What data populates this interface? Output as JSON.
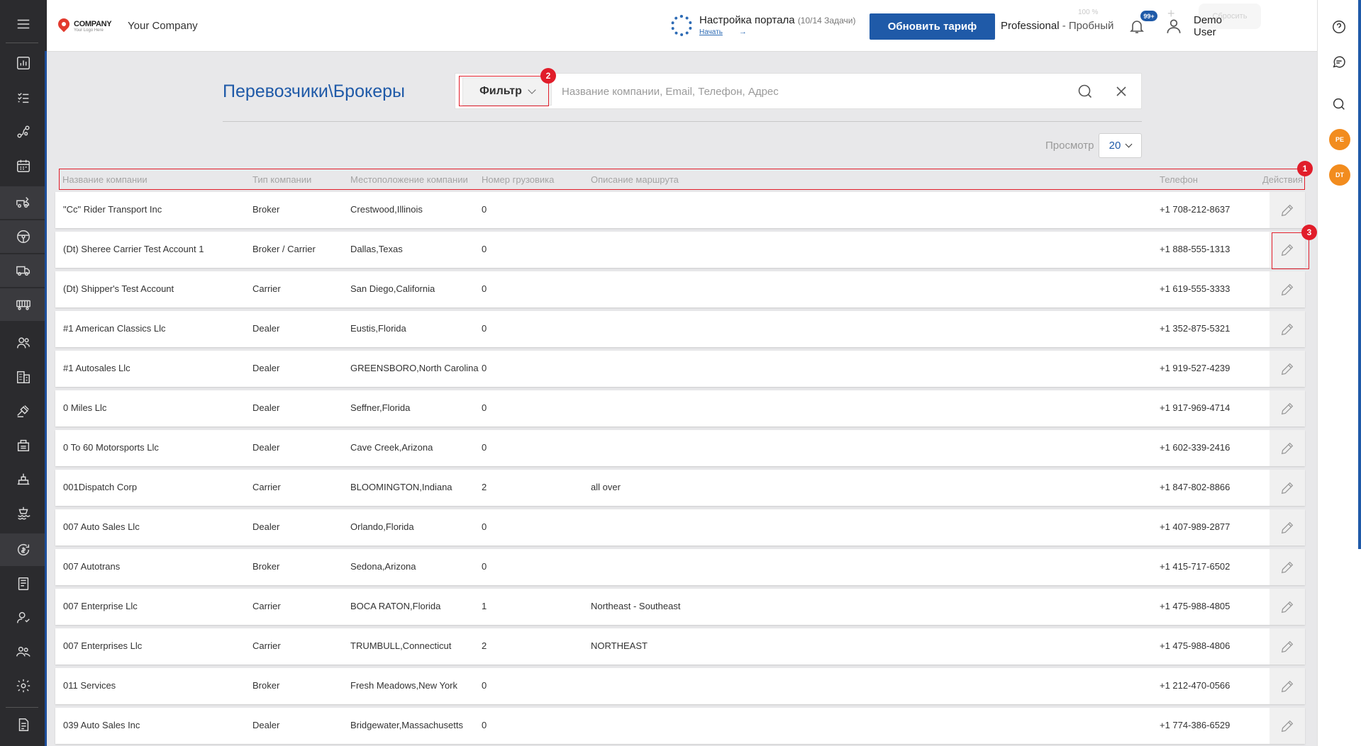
{
  "sidebar": {
    "items": [
      {
        "name": "menu-icon"
      },
      {
        "name": "dashboard-icon"
      },
      {
        "name": "tasks-icon"
      },
      {
        "name": "routes-icon"
      },
      {
        "name": "calendar-icon"
      },
      {
        "name": "dispatch-icon"
      },
      {
        "name": "steering-wheel-icon"
      },
      {
        "name": "truck-icon"
      },
      {
        "name": "trailer-icon"
      },
      {
        "name": "contacts-icon"
      },
      {
        "name": "buildings-icon"
      },
      {
        "name": "auction-icon"
      },
      {
        "name": "warehouse-icon"
      },
      {
        "name": "terminal-icon"
      },
      {
        "name": "port-icon"
      },
      {
        "name": "billing-icon"
      },
      {
        "name": "reports-icon"
      },
      {
        "name": "user-settings-icon"
      },
      {
        "name": "team-icon"
      },
      {
        "name": "settings-icon"
      },
      {
        "name": "document-icon"
      }
    ]
  },
  "header": {
    "logo_text": "COMPANY",
    "logo_sub": "Your Logo Here",
    "company_name": "Your Company",
    "portal_title": "Настройка портала",
    "portal_count": "(10/14 Задачи)",
    "portal_link": "Начать",
    "upgrade_label": "Обновить тариф",
    "plan": "Professional",
    "plan_trial": " - Пробный",
    "ghost_percent": "100 %",
    "ghost_reset": "Сбросить",
    "notifications_badge": "99+",
    "user_name": "Demo User"
  },
  "right_rail": {
    "avatars": [
      "PE",
      "DT"
    ]
  },
  "page": {
    "title": "Перевозчики\\Брокеры",
    "filter_label": "Фильтр",
    "search_placeholder": "Название компании, Email, Телефон, Адрес",
    "view_label": "Просмотр",
    "page_size": "20"
  },
  "table": {
    "columns": [
      "Название компании",
      "Тип компании",
      "Местоположение компании",
      "Номер грузовика",
      "Описание маршрута",
      "Телефон",
      "Действия"
    ],
    "rows": [
      {
        "name": "\"Cc\" Rider Transport Inc",
        "type": "Broker",
        "location": "Crestwood,Illinois",
        "trucks": "0",
        "route": "",
        "phone": "+1 708-212-8637"
      },
      {
        "name": "(Dt) Sheree Carrier Test Account 1",
        "type": "Broker / Carrier",
        "location": "Dallas,Texas",
        "trucks": "0",
        "route": "",
        "phone": "+1 888-555-1313"
      },
      {
        "name": "(Dt) Shipper's Test Account",
        "type": "Carrier",
        "location": "San Diego,California",
        "trucks": "0",
        "route": "",
        "phone": "+1 619-555-3333"
      },
      {
        "name": "#1 American Classics Llc",
        "type": "Dealer",
        "location": "Eustis,Florida",
        "trucks": "0",
        "route": "",
        "phone": "+1 352-875-5321"
      },
      {
        "name": "#1 Autosales Llc",
        "type": "Dealer",
        "location": "GREENSBORO,North Carolina",
        "trucks": "0",
        "route": "",
        "phone": "+1 919-527-4239"
      },
      {
        "name": "0 Miles Llc",
        "type": "Dealer",
        "location": "Seffner,Florida",
        "trucks": "0",
        "route": "",
        "phone": "+1 917-969-4714"
      },
      {
        "name": "0 To 60 Motorsports Llc",
        "type": "Dealer",
        "location": "Cave Creek,Arizona",
        "trucks": "0",
        "route": "",
        "phone": "+1 602-339-2416"
      },
      {
        "name": "001Dispatch Corp",
        "type": "Carrier",
        "location": "BLOOMINGTON,Indiana",
        "trucks": "2",
        "route": "all over",
        "phone": "+1 847-802-8866"
      },
      {
        "name": "007 Auto Sales Llc",
        "type": "Dealer",
        "location": "Orlando,Florida",
        "trucks": "0",
        "route": "",
        "phone": "+1 407-989-2877"
      },
      {
        "name": "007 Autotrans",
        "type": "Broker",
        "location": "Sedona,Arizona",
        "trucks": "0",
        "route": "",
        "phone": "+1 415-717-6502"
      },
      {
        "name": "007 Enterprise Llc",
        "type": "Carrier",
        "location": "BOCA RATON,Florida",
        "trucks": "1",
        "route": "Northeast - Southeast",
        "phone": "+1 475-988-4805"
      },
      {
        "name": "007 Enterprises Llc",
        "type": "Carrier",
        "location": "TRUMBULL,Connecticut",
        "trucks": "2",
        "route": "NORTHEAST",
        "phone": "+1 475-988-4806"
      },
      {
        "name": "011 Services",
        "type": "Broker",
        "location": "Fresh Meadows,New York",
        "trucks": "0",
        "route": "",
        "phone": "+1 212-470-0566"
      },
      {
        "name": "039 Auto Sales Inc",
        "type": "Dealer",
        "location": "Bridgewater,Massachusetts",
        "trucks": "0",
        "route": "",
        "phone": "+1 774-386-6529"
      }
    ]
  },
  "annotations": [
    "1",
    "2",
    "3"
  ],
  "colors": {
    "accent": "#1f5aa8",
    "annotation": "#e11d2a",
    "avatar": "#f28c1e"
  }
}
